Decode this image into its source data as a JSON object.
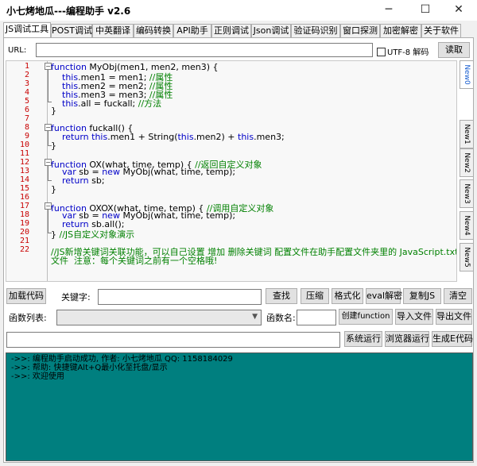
{
  "window": {
    "title": "小七烤地瓜---编程助手 v2.6",
    "minimize_icon": "minimize-icon",
    "maximize_icon": "maximize-icon",
    "close_icon": "close-icon"
  },
  "tabs": [
    "JS调试工具",
    "POST调试",
    "中英翻译",
    "编码转换",
    "API助手",
    "正则调试",
    "Json调试",
    "验证码识别",
    "窗口探测",
    "加密解密",
    "关于软件"
  ],
  "url_bar": {
    "label": "URL:",
    "value": "",
    "utf8_label": "UTF-8 解码",
    "read_label": "读取"
  },
  "editor": {
    "line_numbers": [
      "1",
      "2",
      "3",
      "4",
      "5",
      "6",
      "7",
      "8",
      "9",
      "10",
      "11",
      "12",
      "13",
      "14",
      "15",
      "16",
      "17",
      "18",
      "19",
      "20",
      "21",
      "22"
    ]
  },
  "vertical_tabs": [
    "New0",
    "New1",
    "New2",
    "New3",
    "New4",
    "New5"
  ],
  "toolbar": {
    "load_code": "加载代码",
    "keyword_label": "关键字:",
    "keyword_value": "",
    "find": "查找",
    "compress": "压缩",
    "format": "格式化",
    "eval_decrypt": "eval解密",
    "copy_js": "复制JS",
    "clear": "清空",
    "function_list_label": "函数列表:",
    "function_list_value": "",
    "function_name_label": "函数名:",
    "function_name_value": "",
    "create_function": "创建function",
    "import_file": "导入文件",
    "export_file": "导出文件",
    "extra_input_value": "",
    "system_run": "系统运行",
    "browser_run": "浏览器运行",
    "generate_e_code": "生成E代码"
  },
  "console": {
    "lines": [
      "->>: 编程助手启动成功, 作者: 小七烤地瓜  QQ: 1158184029",
      "->>: 帮助: 快捷键Alt+Q最小化至托盘/显示",
      "->>: 欢迎使用"
    ]
  }
}
